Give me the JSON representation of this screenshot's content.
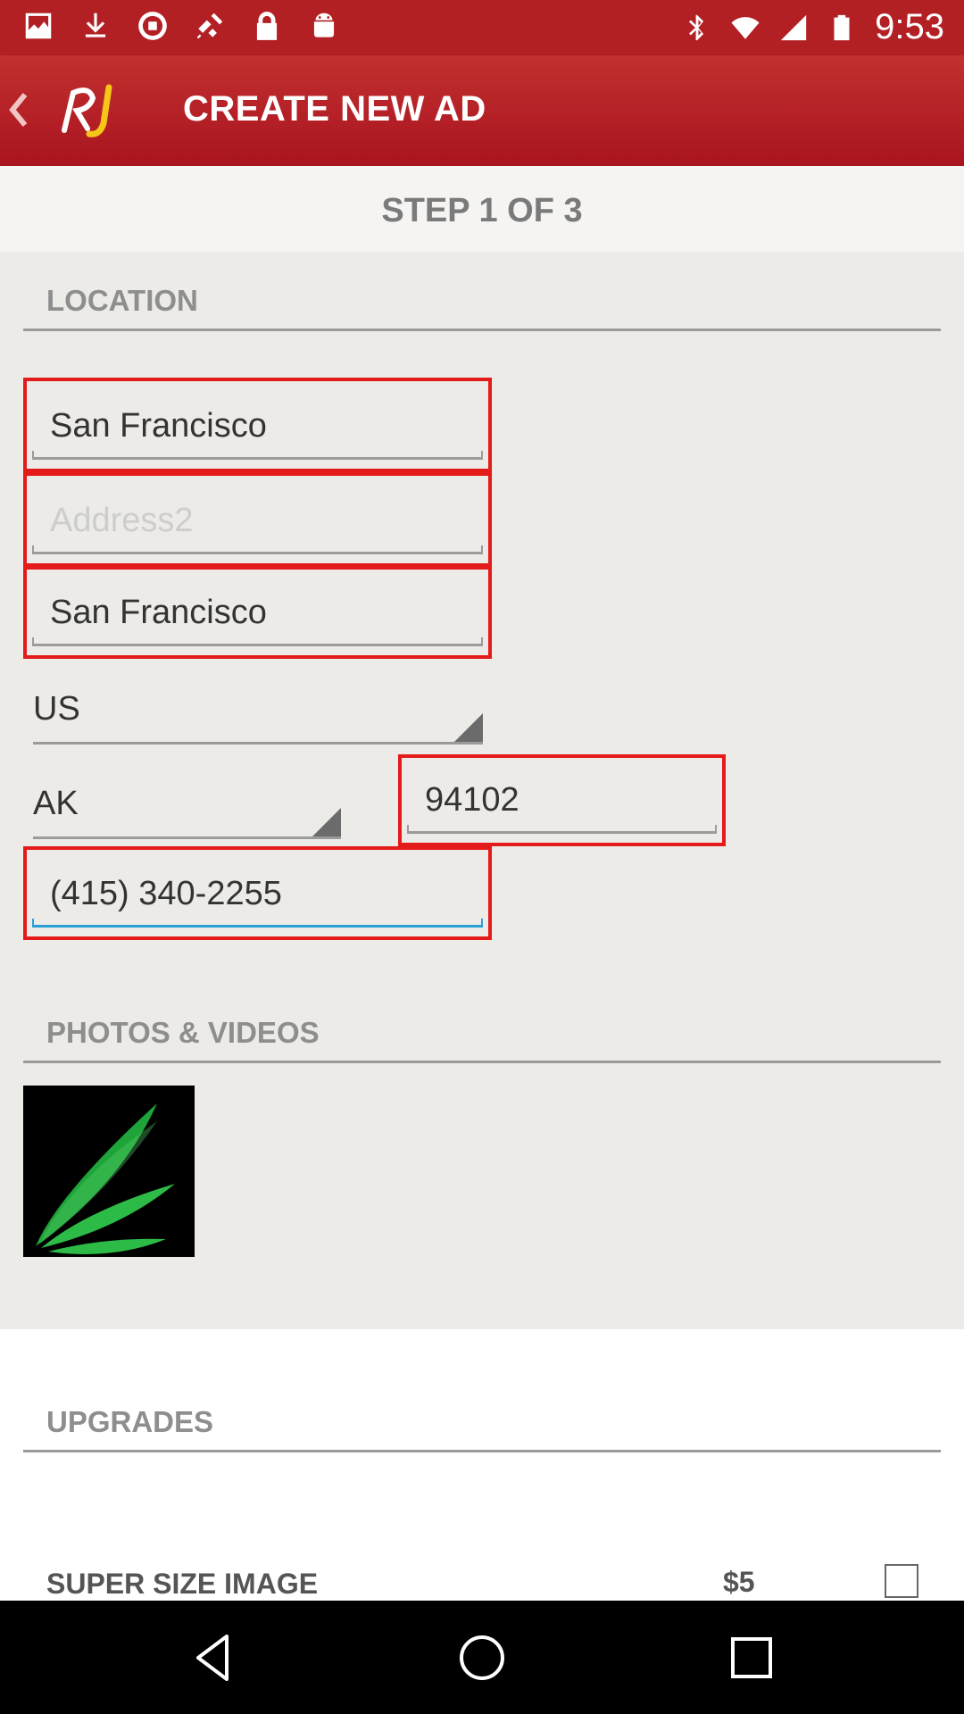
{
  "status_bar": {
    "time": "9:53",
    "left_icons": [
      "image-icon",
      "download-icon",
      "circle-icon",
      "satellite-icon",
      "lock-icon",
      "android-icon"
    ],
    "right_icons": [
      "bluetooth-icon",
      "wifi-icon",
      "signal-icon",
      "battery-icon"
    ]
  },
  "app_bar": {
    "title": "CREATE NEW AD",
    "logo_text": "RJ",
    "brand_color": "#b71c1c"
  },
  "step": {
    "label": "STEP 1 OF 3"
  },
  "location": {
    "header": "LOCATION",
    "address1": {
      "value": "San Francisco"
    },
    "address2": {
      "placeholder": "Address2"
    },
    "city": {
      "value": "San Francisco"
    },
    "country": {
      "value": "US"
    },
    "state": {
      "value": "AK"
    },
    "zip": {
      "value": "94102"
    },
    "phone": {
      "value": "(415) 340-2255"
    }
  },
  "media": {
    "header": "PHOTOS & VIDEOS",
    "thumbnail_icon": "green-leaf-logo-icon"
  },
  "upgrades": {
    "header": "UPGRADES",
    "items": [
      {
        "label": "SUPER SIZE IMAGE",
        "price": "$5",
        "checked": false
      }
    ]
  },
  "colors": {
    "error_outline": "#e41b1b",
    "focus_underline": "#2a9fd6",
    "section_text": "#8e8e8e"
  }
}
